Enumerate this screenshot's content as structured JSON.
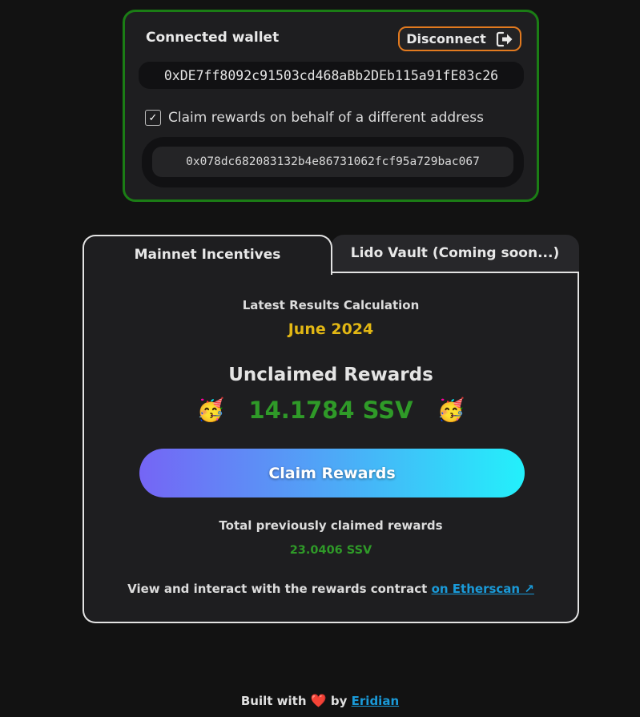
{
  "wallet": {
    "title": "Connected wallet",
    "disconnect_label": "Disconnect",
    "disconnect_icon": "logout-icon",
    "address": "0xDE7ff8092c91503cd468aBb2DEb115a91fE83c26",
    "behalf_checked": true,
    "behalf_label": "Claim rewards on behalf of a different address",
    "behalf_address": "0x078dc682083132b4e86731062fcf95a729bac067"
  },
  "tabs": [
    {
      "label": "Mainnet Incentives",
      "active": true
    },
    {
      "label": "Lido Vault (Coming soon...)",
      "active": false
    }
  ],
  "rewards": {
    "calc_label": "Latest Results Calculation",
    "calc_date": "June 2024",
    "unclaimed_title": "Unclaimed Rewards",
    "emoji": "🥳",
    "unclaimed_amount": "14.1784 SSV",
    "claim_button": "Claim Rewards",
    "previous_label": "Total previously claimed rewards",
    "previous_amount": "23.0406 SSV",
    "contract_text": "View and interact with the rewards contract",
    "contract_link": "on Etherscan ↗"
  },
  "footer": {
    "built_with": "Built with",
    "heart": "❤️",
    "by": "by",
    "author": "Eridian"
  },
  "colors": {
    "wallet_border": "#1b7d15",
    "disconnect_border": "#e27a1f",
    "date": "#e2b714",
    "amount": "#2f9a28",
    "link": "#1a9ad8"
  }
}
